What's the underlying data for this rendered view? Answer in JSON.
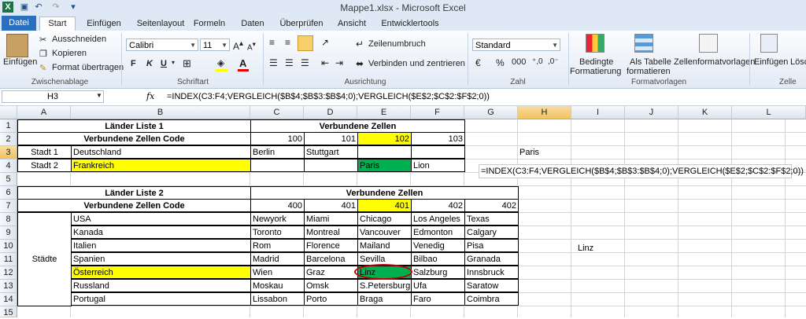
{
  "window": {
    "title": "Mappe1.xlsx - Microsoft Excel"
  },
  "tabs": [
    "Datei",
    "Start",
    "Einfügen",
    "Seitenlayout",
    "Formeln",
    "Daten",
    "Überprüfen",
    "Ansicht",
    "Entwicklertools"
  ],
  "ribbon": {
    "clipboard": {
      "paste": "Einfügen",
      "cut": "Ausschneiden",
      "copy": "Kopieren",
      "format_painter": "Format übertragen",
      "label": "Zwischenablage"
    },
    "font": {
      "name": "Calibri",
      "size": "11",
      "bold": "F",
      "italic": "K",
      "underline": "U",
      "label": "Schriftart"
    },
    "alignment": {
      "wrap": "Zeilenumbruch",
      "merge": "Verbinden und zentrieren",
      "label": "Ausrichtung"
    },
    "number": {
      "format": "Standard",
      "label": "Zahl"
    },
    "styles": {
      "conditional": "Bedingte",
      "conditional2": "Formatierung",
      "as_table": "Als Tabelle",
      "as_table2": "formatieren",
      "cell_styles": "Zellenformatvorlagen",
      "label": "Formatvorlagen"
    },
    "cells": {
      "insert": "Einfügen",
      "delete": "Lösc",
      "label": "Zelle"
    }
  },
  "formula_bar": {
    "name_box": "H3",
    "fx": "fx",
    "formula": "=INDEX(C3:F4;VERGLEICH($B$4;$B$3:$B$4;0);VERGLEICH($E$2;$C$2:$F$2;0))"
  },
  "columns": [
    "A",
    "B",
    "C",
    "D",
    "E",
    "F",
    "G",
    "H",
    "I",
    "J",
    "K",
    "L"
  ],
  "rows": [
    "1",
    "2",
    "3",
    "4",
    "5",
    "6",
    "7",
    "8",
    "9",
    "10",
    "11",
    "12",
    "13",
    "14",
    "15"
  ],
  "sheet": {
    "t1_title": "Länder Liste 1",
    "t1_vz": "Verbundene Zellen",
    "t1_code": "Verbundene Zellen Code",
    "t1_nums": [
      "100",
      "101",
      "102",
      "103"
    ],
    "t1_stadt1": "Stadt 1",
    "t1_stadt2": "Stadt 2",
    "t1_de": "Deutschland",
    "t1_fr": "Frankreich",
    "t1_berlin": "Berlin",
    "t1_stuttgart": "Stuttgart",
    "t1_paris": "Paris",
    "t1_lion": "Lion",
    "h3_value": "Paris",
    "formula_text": "=INDEX(C3:F4;VERGLEICH($B$4;$B$3:$B$4;0);VERGLEICH($E$2;$C$2:$F$2;0))",
    "t2_title": "Länder Liste 2",
    "t2_vz": "Verbundene Zellen",
    "t2_code": "Verbundene Zellen Code",
    "t2_nums": [
      "400",
      "401",
      "401",
      "402",
      "402"
    ],
    "t2_staedte": "Städte",
    "countries": [
      "USA",
      "Kanada",
      "Italien",
      "Spanien",
      "Österreich",
      "Russland",
      "Portugal"
    ],
    "cities": [
      [
        "Newyork",
        "Miami",
        "Chicago",
        "Los Angeles",
        "Texas"
      ],
      [
        "Toronto",
        "Montreal",
        "Vancouver",
        "Edmonton",
        "Calgary"
      ],
      [
        "Rom",
        "Florence",
        "Mailand",
        "Venedig",
        "Pisa"
      ],
      [
        "Madrid",
        "Barcelona",
        "Sevilla",
        "Bilbao",
        "Granada"
      ],
      [
        "Wien",
        "Graz",
        "Linz",
        "Salzburg",
        "Innsbruck"
      ],
      [
        "Moskau",
        "Omsk",
        "S.Petersburg",
        "Ufa",
        "Saratow"
      ],
      [
        "Lissabon",
        "Porto",
        "Braga",
        "Faro",
        "Coimbra"
      ]
    ],
    "i11_value": "Linz"
  },
  "colors": {
    "highlight_yellow": "#ffff00",
    "highlight_green": "#00b050",
    "ring_red": "#c00000",
    "file_tab": "#2b6fc1"
  }
}
